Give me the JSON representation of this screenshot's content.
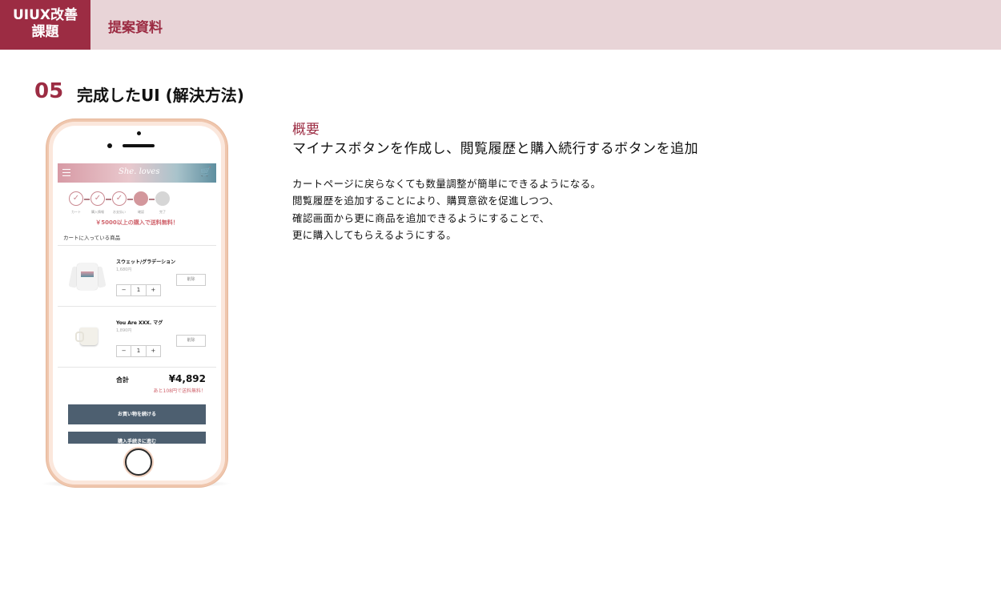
{
  "header": {
    "badge_line1": "UIUX改善",
    "badge_line2": "課題",
    "title": "提案資料"
  },
  "section": {
    "number": "05",
    "title": "完成したUI (解決方法)"
  },
  "summary": {
    "label": "概要",
    "lead": "マイナスボタンを作成し、閲覧履歴と購入続行するボタンを追加",
    "lines": [
      "カートページに戻らなくても数量調整が簡単にできるようになる。",
      "閲覧履歴を追加することにより、購買意欲を促進しつつ、",
      "確認画面から更に商品を追加できるようにすることで、",
      "更に購入してもらえるようにする。"
    ]
  },
  "mock": {
    "logo": "She. loves",
    "steps": [
      {
        "label": "カート",
        "state": "done"
      },
      {
        "label": "購入情報",
        "state": "done"
      },
      {
        "label": "お支払い",
        "state": "done"
      },
      {
        "label": "確認",
        "state": "current"
      },
      {
        "label": "完了",
        "state": "todo"
      }
    ],
    "promo": "￥5000以上の購入で送料無料！",
    "cart_heading": "カートに入っている商品",
    "items": [
      {
        "name": "スウェット/グラデーション",
        "price": "1,680円",
        "qty": "1",
        "minus": "−",
        "plus": "+",
        "delete": "削除"
      },
      {
        "name": "You Are XXX. マグ",
        "price": "1,890円",
        "qty": "1",
        "minus": "−",
        "plus": "+",
        "delete": "削除"
      }
    ],
    "total_label": "合計",
    "total_value": "¥4,892",
    "total_note": "あと108円で送料無料！",
    "cta_continue": "お買い物を続ける",
    "cta_checkout": "購入手続きに進む"
  },
  "colors": {
    "accent": "#9c2c43",
    "header_bg": "#e8d4d7",
    "button": "#4d5f70",
    "promo": "#d0646d"
  }
}
